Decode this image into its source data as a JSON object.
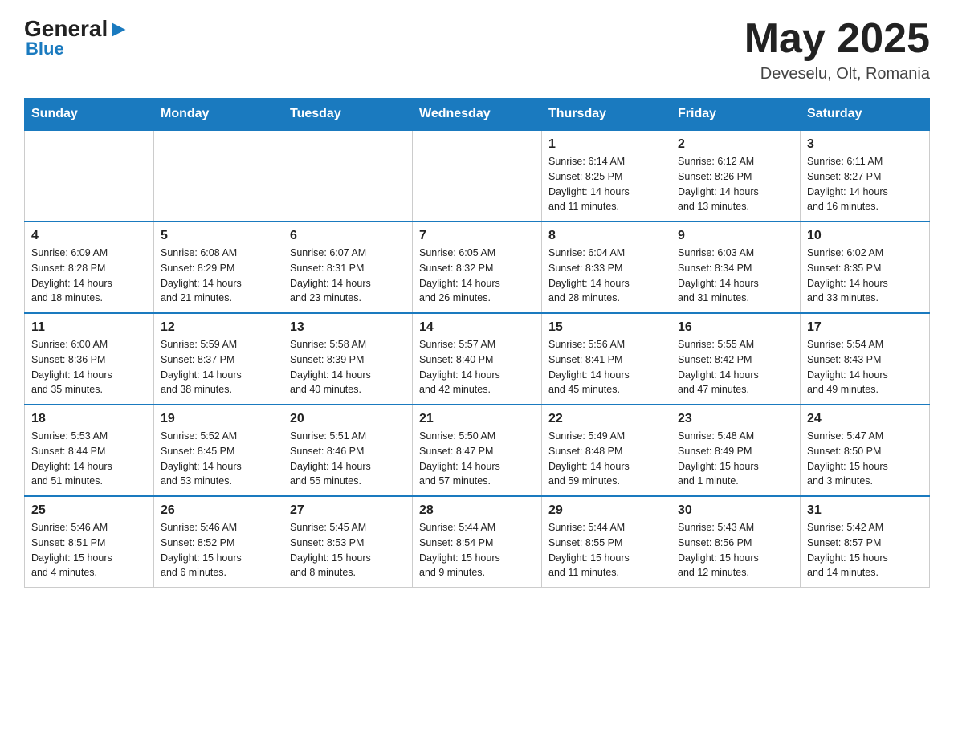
{
  "header": {
    "logo_general": "General",
    "logo_blue": "Blue",
    "month_title": "May 2025",
    "location": "Deveselu, Olt, Romania"
  },
  "weekdays": [
    "Sunday",
    "Monday",
    "Tuesday",
    "Wednesday",
    "Thursday",
    "Friday",
    "Saturday"
  ],
  "weeks": [
    [
      {
        "day": "",
        "info": ""
      },
      {
        "day": "",
        "info": ""
      },
      {
        "day": "",
        "info": ""
      },
      {
        "day": "",
        "info": ""
      },
      {
        "day": "1",
        "info": "Sunrise: 6:14 AM\nSunset: 8:25 PM\nDaylight: 14 hours\nand 11 minutes."
      },
      {
        "day": "2",
        "info": "Sunrise: 6:12 AM\nSunset: 8:26 PM\nDaylight: 14 hours\nand 13 minutes."
      },
      {
        "day": "3",
        "info": "Sunrise: 6:11 AM\nSunset: 8:27 PM\nDaylight: 14 hours\nand 16 minutes."
      }
    ],
    [
      {
        "day": "4",
        "info": "Sunrise: 6:09 AM\nSunset: 8:28 PM\nDaylight: 14 hours\nand 18 minutes."
      },
      {
        "day": "5",
        "info": "Sunrise: 6:08 AM\nSunset: 8:29 PM\nDaylight: 14 hours\nand 21 minutes."
      },
      {
        "day": "6",
        "info": "Sunrise: 6:07 AM\nSunset: 8:31 PM\nDaylight: 14 hours\nand 23 minutes."
      },
      {
        "day": "7",
        "info": "Sunrise: 6:05 AM\nSunset: 8:32 PM\nDaylight: 14 hours\nand 26 minutes."
      },
      {
        "day": "8",
        "info": "Sunrise: 6:04 AM\nSunset: 8:33 PM\nDaylight: 14 hours\nand 28 minutes."
      },
      {
        "day": "9",
        "info": "Sunrise: 6:03 AM\nSunset: 8:34 PM\nDaylight: 14 hours\nand 31 minutes."
      },
      {
        "day": "10",
        "info": "Sunrise: 6:02 AM\nSunset: 8:35 PM\nDaylight: 14 hours\nand 33 minutes."
      }
    ],
    [
      {
        "day": "11",
        "info": "Sunrise: 6:00 AM\nSunset: 8:36 PM\nDaylight: 14 hours\nand 35 minutes."
      },
      {
        "day": "12",
        "info": "Sunrise: 5:59 AM\nSunset: 8:37 PM\nDaylight: 14 hours\nand 38 minutes."
      },
      {
        "day": "13",
        "info": "Sunrise: 5:58 AM\nSunset: 8:39 PM\nDaylight: 14 hours\nand 40 minutes."
      },
      {
        "day": "14",
        "info": "Sunrise: 5:57 AM\nSunset: 8:40 PM\nDaylight: 14 hours\nand 42 minutes."
      },
      {
        "day": "15",
        "info": "Sunrise: 5:56 AM\nSunset: 8:41 PM\nDaylight: 14 hours\nand 45 minutes."
      },
      {
        "day": "16",
        "info": "Sunrise: 5:55 AM\nSunset: 8:42 PM\nDaylight: 14 hours\nand 47 minutes."
      },
      {
        "day": "17",
        "info": "Sunrise: 5:54 AM\nSunset: 8:43 PM\nDaylight: 14 hours\nand 49 minutes."
      }
    ],
    [
      {
        "day": "18",
        "info": "Sunrise: 5:53 AM\nSunset: 8:44 PM\nDaylight: 14 hours\nand 51 minutes."
      },
      {
        "day": "19",
        "info": "Sunrise: 5:52 AM\nSunset: 8:45 PM\nDaylight: 14 hours\nand 53 minutes."
      },
      {
        "day": "20",
        "info": "Sunrise: 5:51 AM\nSunset: 8:46 PM\nDaylight: 14 hours\nand 55 minutes."
      },
      {
        "day": "21",
        "info": "Sunrise: 5:50 AM\nSunset: 8:47 PM\nDaylight: 14 hours\nand 57 minutes."
      },
      {
        "day": "22",
        "info": "Sunrise: 5:49 AM\nSunset: 8:48 PM\nDaylight: 14 hours\nand 59 minutes."
      },
      {
        "day": "23",
        "info": "Sunrise: 5:48 AM\nSunset: 8:49 PM\nDaylight: 15 hours\nand 1 minute."
      },
      {
        "day": "24",
        "info": "Sunrise: 5:47 AM\nSunset: 8:50 PM\nDaylight: 15 hours\nand 3 minutes."
      }
    ],
    [
      {
        "day": "25",
        "info": "Sunrise: 5:46 AM\nSunset: 8:51 PM\nDaylight: 15 hours\nand 4 minutes."
      },
      {
        "day": "26",
        "info": "Sunrise: 5:46 AM\nSunset: 8:52 PM\nDaylight: 15 hours\nand 6 minutes."
      },
      {
        "day": "27",
        "info": "Sunrise: 5:45 AM\nSunset: 8:53 PM\nDaylight: 15 hours\nand 8 minutes."
      },
      {
        "day": "28",
        "info": "Sunrise: 5:44 AM\nSunset: 8:54 PM\nDaylight: 15 hours\nand 9 minutes."
      },
      {
        "day": "29",
        "info": "Sunrise: 5:44 AM\nSunset: 8:55 PM\nDaylight: 15 hours\nand 11 minutes."
      },
      {
        "day": "30",
        "info": "Sunrise: 5:43 AM\nSunset: 8:56 PM\nDaylight: 15 hours\nand 12 minutes."
      },
      {
        "day": "31",
        "info": "Sunrise: 5:42 AM\nSunset: 8:57 PM\nDaylight: 15 hours\nand 14 minutes."
      }
    ]
  ]
}
